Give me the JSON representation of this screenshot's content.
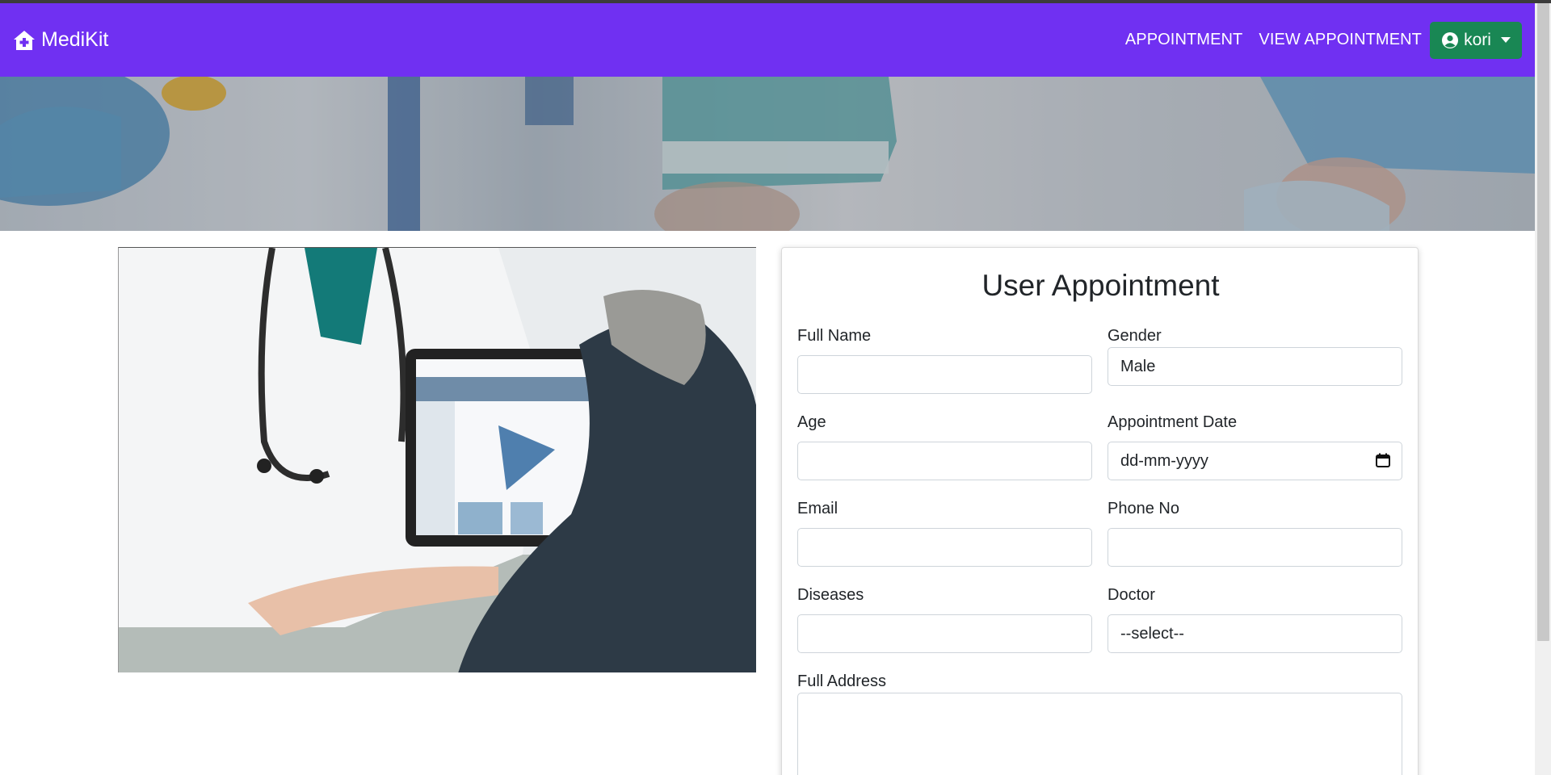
{
  "brand": {
    "name": "MediKit",
    "icon": "house-medical-icon"
  },
  "nav": {
    "links": [
      "APPOINTMENT",
      "VIEW APPOINTMENT"
    ],
    "user": {
      "name": "kori",
      "icon": "user-circle-icon"
    }
  },
  "form": {
    "title": "User Appointment",
    "full_name": {
      "label": "Full Name",
      "value": ""
    },
    "gender": {
      "label": "Gender",
      "value": "Male"
    },
    "age": {
      "label": "Age",
      "value": ""
    },
    "appointment_date": {
      "label": "Appointment Date",
      "placeholder": "dd-mm-yyyy"
    },
    "email": {
      "label": "Email",
      "value": ""
    },
    "phone": {
      "label": "Phone No",
      "value": ""
    },
    "diseases": {
      "label": "Diseases",
      "value": ""
    },
    "doctor": {
      "label": "Doctor",
      "value": "--select--"
    },
    "address": {
      "label": "Full Address",
      "value": ""
    }
  },
  "colors": {
    "navbar": "#7030f2",
    "user_button": "#198754"
  }
}
